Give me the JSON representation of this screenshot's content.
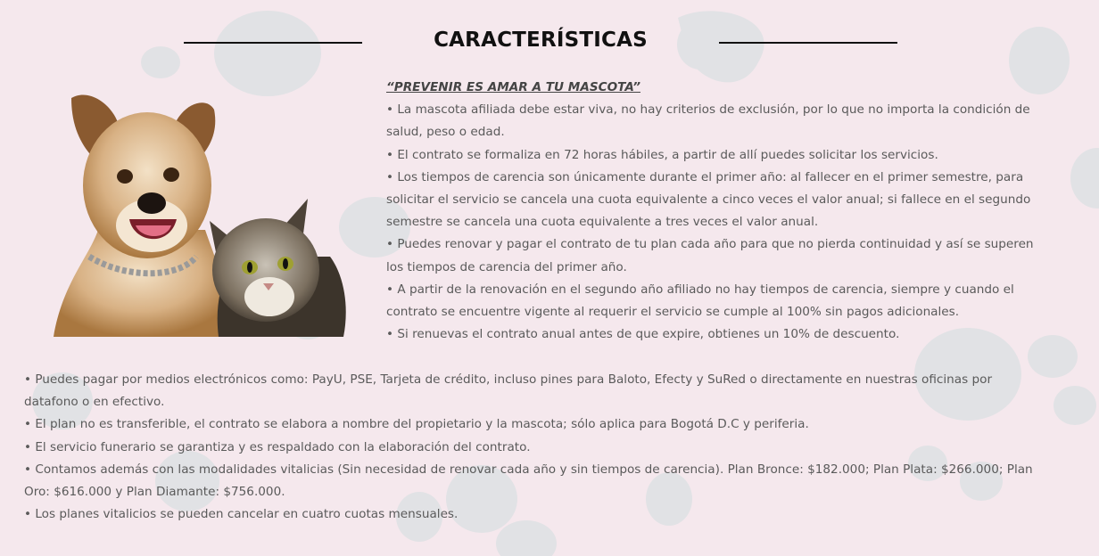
{
  "section": {
    "title": "CARACTERÍSTICAS",
    "slogan": "“PREVENIR ES AMAR A TU MASCOTA”",
    "right_items": [
      "• La mascota afiliada debe estar viva, no hay criterios de exclusión, por lo que no importa la condición de salud, peso o edad.",
      "• El contrato se formaliza en 72 horas hábiles, a partir de allí puedes solicitar los servicios.",
      "• Los tiempos de carencia son únicamente durante el primer año: al fallecer en el primer semestre, para solicitar el servicio se cancela una cuota equivalente a cinco veces el valor anual; si fallece en el segundo semestre se cancela una cuota equivalente a tres veces el valor anual.",
      "• Puedes renovar y pagar el contrato de tu plan cada año para que no pierda continuidad y así se superen los tiempos de carencia del primer año.",
      "• A partir de la renovación en el segundo año afiliado no hay tiempos de carencia, siempre y cuando el contrato se encuentre vigente al requerir el servicio se cumple al 100% sin pagos adicionales.",
      "• Si renuevas el contrato anual antes de que expire, obtienes un 10% de descuento."
    ],
    "bottom_items": [
      "• Puedes pagar por medios electrónicos como: PayU, PSE, Tarjeta de crédito, incluso pines para Baloto, Efecty y SuRed o directamente en nuestras oficinas por datafono o en efectivo.",
      "• El plan no es transferible, el contrato se elabora a nombre del propietario y la mascota; sólo aplica para Bogotá D.C y periferia.",
      "• El servicio funerario se garantiza y es respaldado con la elaboración del contrato.",
      "• Contamos además con las modalidades vitalicias (Sin necesidad de renovar cada año y sin tiempos de carencia). Plan Bronce: $182.000; Plan Plata: $266.000; Plan Oro: $616.000 y Plan Diamante: $756.000.",
      "• Los planes vitalicios se pueden cancelar en cuatro cuotas mensuales."
    ]
  },
  "colors": {
    "background": "#f5e8ed",
    "paw_print": "#dde0e3",
    "title": "#111111",
    "body_text": "#5a5a5a"
  },
  "image": {
    "subject": "dog-and-cat-photo"
  }
}
